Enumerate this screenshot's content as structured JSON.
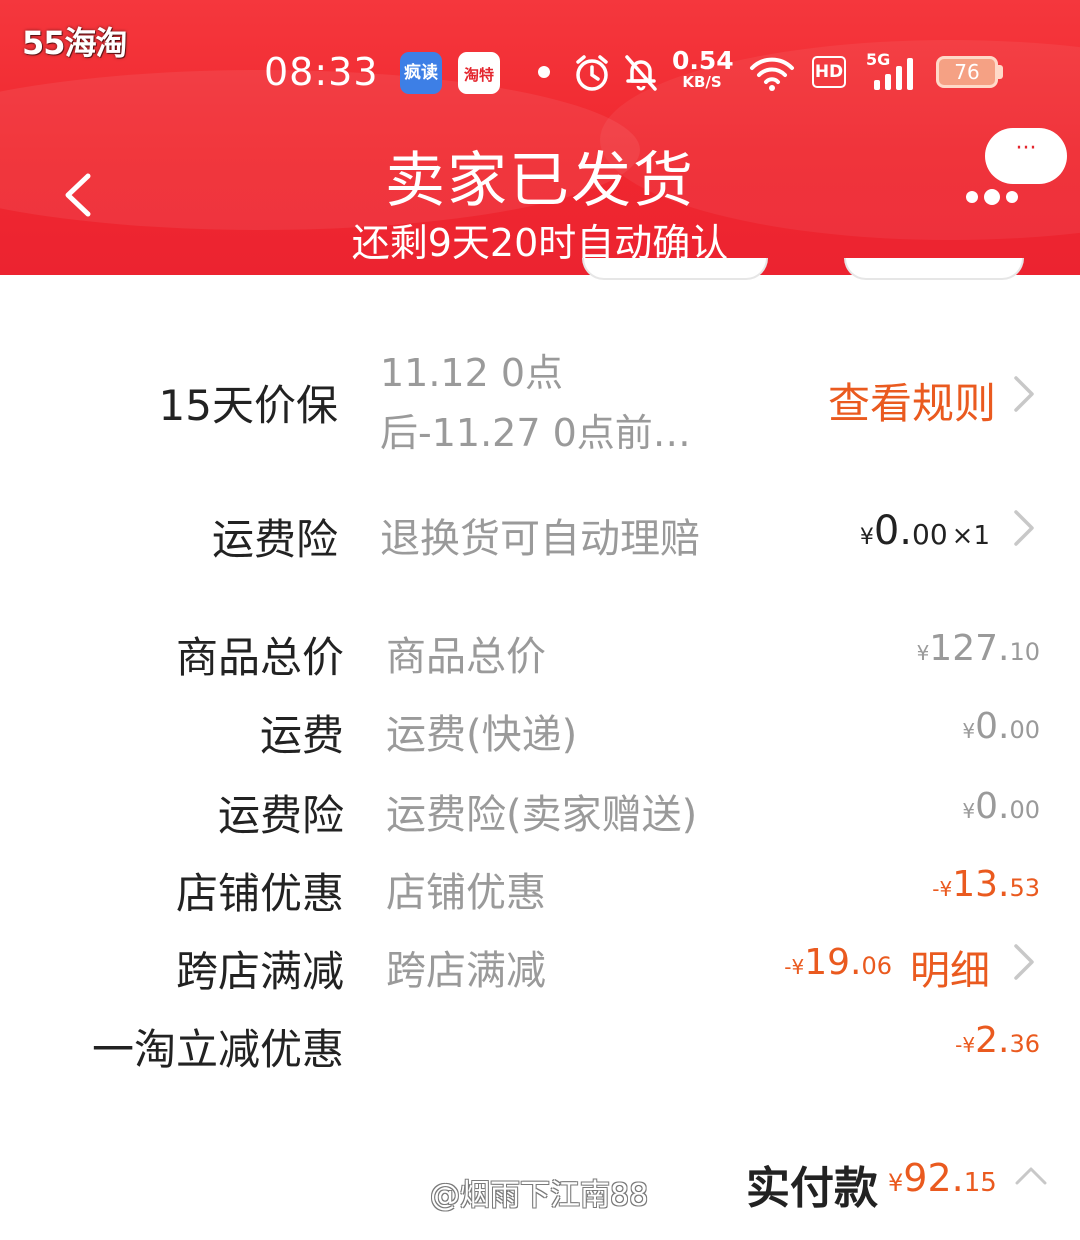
{
  "watermark_brand": "55海淘",
  "status_bar": {
    "time": "08:33",
    "app1": "疯读",
    "app2": "淘特",
    "net_speed_value": "0.54",
    "net_speed_unit": "KB/S",
    "hd": "HD",
    "network": "5G",
    "battery": "76"
  },
  "header": {
    "title": "卖家已发货",
    "subtitle": "还剩9天20时自动确认",
    "more_label": "···"
  },
  "price_protect": {
    "label": "15天价保",
    "desc_line1": "11.12 0点",
    "desc_line2": "后-11.27 0点前…",
    "action": "查看规则"
  },
  "shipping_insurance": {
    "label": "运费险",
    "desc": "退换货可自动理赔",
    "currency": "¥",
    "amount_int": "0.",
    "amount_dec": "00",
    "qty": "×1"
  },
  "price_rows": [
    {
      "label": "商品总价",
      "desc": "商品总价",
      "sign": "",
      "currency": "¥",
      "int": "127.",
      "dec": "10"
    },
    {
      "label": "运费",
      "desc": "运费(快递)",
      "sign": "",
      "currency": "¥",
      "int": "0.",
      "dec": "00"
    },
    {
      "label": "运费险",
      "desc": "运费险(卖家赠送)",
      "sign": "",
      "currency": "¥",
      "int": "0.",
      "dec": "00"
    },
    {
      "label": "店铺优惠",
      "desc": "店铺优惠",
      "sign": "-",
      "currency": "¥",
      "int": "13.",
      "dec": "53"
    },
    {
      "label": "跨店满减",
      "desc": "跨店满减",
      "sign": "-",
      "currency": "¥",
      "int": "19.",
      "dec": "06",
      "action": "明细"
    },
    {
      "label": "一淘立减优惠",
      "desc": "",
      "sign": "-",
      "currency": "¥",
      "int": "2.",
      "dec": "36"
    }
  ],
  "total": {
    "label": "实付款",
    "currency": "¥",
    "int": "92.",
    "dec": "15"
  },
  "watermark_user": "@烟雨下江南88",
  "colors": {
    "header_red": "#f0282f",
    "accent_orange": "#ea5a1f",
    "text_dark": "#222222",
    "text_gray": "#9a9a9a"
  }
}
